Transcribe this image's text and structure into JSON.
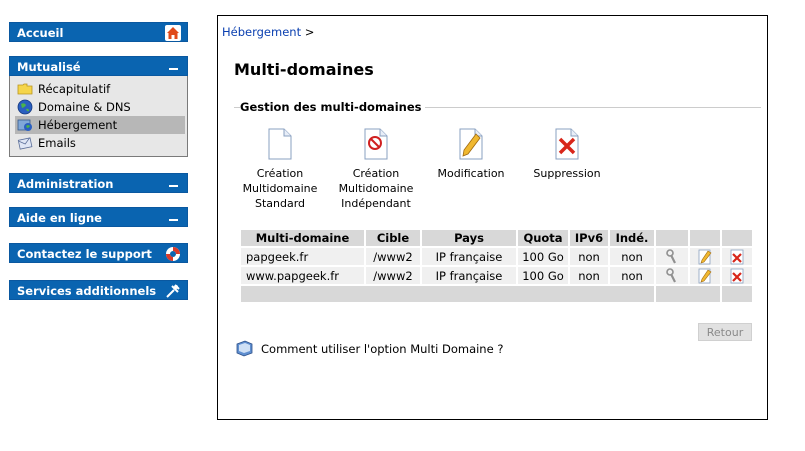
{
  "sidebar": {
    "accueil": {
      "label": "Accueil",
      "icon": "home-icon"
    },
    "mutualise": {
      "label": "Mutualisé",
      "items": [
        {
          "label": "Récapitulatif",
          "icon": "folder-icon"
        },
        {
          "label": "Domaine & DNS",
          "icon": "globe-icon"
        },
        {
          "label": "Hébergement",
          "icon": "hosting-icon",
          "active": true
        },
        {
          "label": "Emails",
          "icon": "email-icon"
        }
      ]
    },
    "administration": {
      "label": "Administration"
    },
    "aide": {
      "label": "Aide en ligne"
    },
    "support": {
      "label": "Contactez le support",
      "icon": "lifebuoy-icon"
    },
    "services": {
      "label": "Services additionnels",
      "icon": "tools-icon"
    }
  },
  "main": {
    "breadcrumb": {
      "link": "Hébergement",
      "sep": ">"
    },
    "title": "Multi-domaines",
    "section": "Gestion des multi-domaines",
    "actions": [
      {
        "line1": "Création",
        "line2": "Multidomaine",
        "line3": "Standard",
        "icon": "document-icon"
      },
      {
        "line1": "Création",
        "line2": "Multidomaine",
        "line3": "Indépendant",
        "icon": "document-forbidden-icon"
      },
      {
        "line1": "Modification",
        "line2": "",
        "line3": "",
        "icon": "edit-icon"
      },
      {
        "line1": "Suppression",
        "line2": "",
        "line3": "",
        "icon": "delete-icon"
      }
    ],
    "table": {
      "headers": [
        "Multi-domaine",
        "Cible",
        "Pays",
        "Quota",
        "IPv6",
        "Indé."
      ],
      "rows": [
        {
          "domain": "papgeek.fr",
          "cible": "/www2",
          "pays": "IP française",
          "quota": "100 Go",
          "ipv6": "non",
          "inde": "non"
        },
        {
          "domain": "www.papgeek.fr",
          "cible": "/www2",
          "pays": "IP française",
          "quota": "100 Go",
          "ipv6": "non",
          "inde": "non"
        }
      ]
    },
    "retour": "Retour",
    "help": "Comment utiliser l'option Multi Domaine ?"
  },
  "colors": {
    "accent": "#0a64b0",
    "active_item": "#b7b7b7",
    "table_header": "#d8d8d8"
  }
}
